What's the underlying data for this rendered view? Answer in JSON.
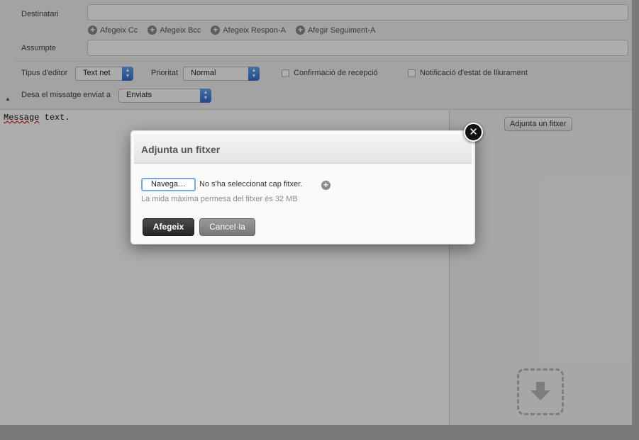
{
  "headers": {
    "to_label": "Destinatari",
    "add_links": [
      "Afegeix Cc",
      "Afegeix Bcc",
      "Afegeix Respon-A",
      "Afegir Seguiment-A"
    ],
    "subject_label": "Assumpte",
    "editor_type_label": "Tipus d'editor",
    "editor_type_value": "Text net",
    "priority_label": "Prioritat",
    "priority_value": "Normal",
    "read_receipt_label": "Confirmació de recepció",
    "delivery_status_label": "Notificació d'estat de lliurament",
    "save_sent_label": "Desa el missatge enviat a",
    "save_sent_value": "Enviats"
  },
  "editor": {
    "text_misspelled": "Message",
    "text_rest": " text."
  },
  "attachments": {
    "button_label": "Adjunta un fitxer",
    "drop_icon": "download-arrow-icon"
  },
  "dialog": {
    "title": "Adjunta un fitxer",
    "close_symbol": "✕",
    "browse_label": "Navega…",
    "no_file_text": "No s'ha seleccionat cap fitxer.",
    "max_size_text": "La mida màxima permesa del fitxer és 32 MB",
    "primary_label": "Afegeix",
    "secondary_label": "Cancel·la"
  },
  "colors": {
    "overlay": "rgba(0,0,0,0.32)",
    "select_accent": "#2f6fd0",
    "primary_button": "#262626"
  }
}
